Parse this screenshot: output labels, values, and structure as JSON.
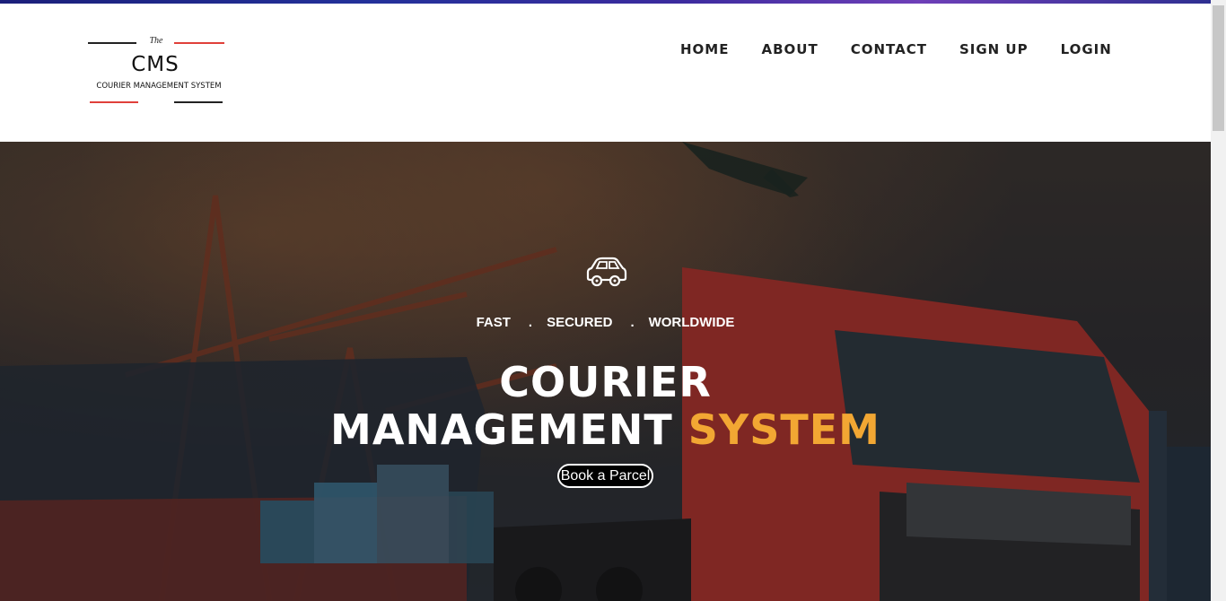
{
  "logo": {
    "the": "The",
    "short": "CMS",
    "full": "COURIER MANAGEMENT SYSTEM"
  },
  "nav": {
    "items": [
      {
        "label": "HOME"
      },
      {
        "label": "ABOUT"
      },
      {
        "label": "CONTACT"
      },
      {
        "label": "SIGN UP"
      },
      {
        "label": "LOGIN"
      }
    ]
  },
  "hero": {
    "icon": "car-icon",
    "tags": [
      "FAST",
      "SECURED",
      "WORLDWIDE"
    ],
    "separator": ".",
    "title_line1": "COURIER",
    "title_line2_main": "MANAGEMENT",
    "title_line2_accent": "SYSTEM",
    "button_label": "Book a Parcel"
  },
  "colors": {
    "accent": "#f2a733",
    "nav_text": "#222222",
    "logo_red": "#e0403a"
  }
}
